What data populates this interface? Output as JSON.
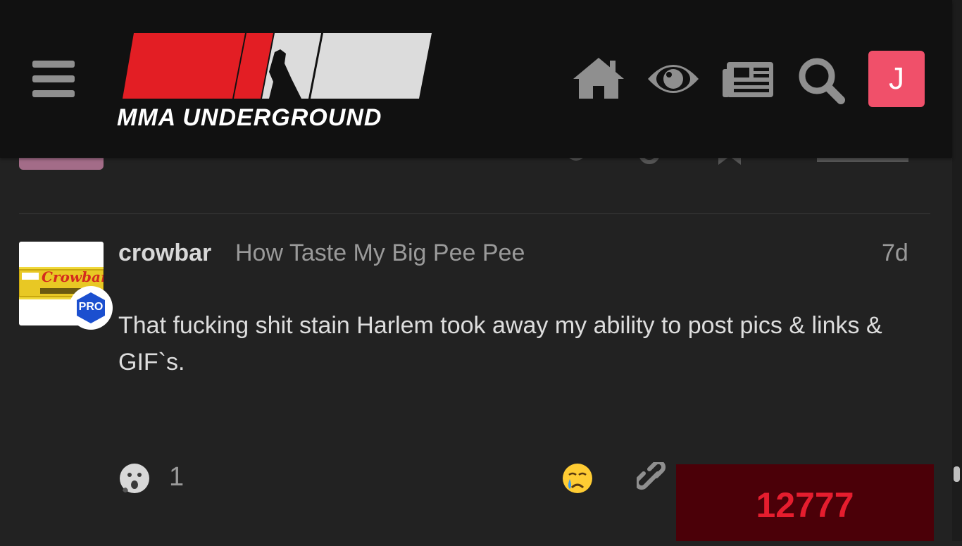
{
  "header": {
    "logo_text": "MMA UNDERGROUND",
    "avatar_letter": "J",
    "icons": [
      "menu-icon",
      "home-icon",
      "eye-icon",
      "newspaper-icon",
      "search-icon"
    ],
    "colors": {
      "header_bg": "#111111",
      "logo_red": "#e31e24",
      "logo_gray": "#dcdcdc",
      "avatar_bg": "#f0506a"
    }
  },
  "post": {
    "username": "crowbar",
    "user_title": "How Taste My Big Pee Pee",
    "date": "7d",
    "body": "That fucking shit stain Harlem took away my ability to post pics & links & GIF`s.",
    "badge": "PRO",
    "avatar_label": "Crowbar",
    "reaction_count": "1"
  },
  "overlay": {
    "number": "12777"
  }
}
